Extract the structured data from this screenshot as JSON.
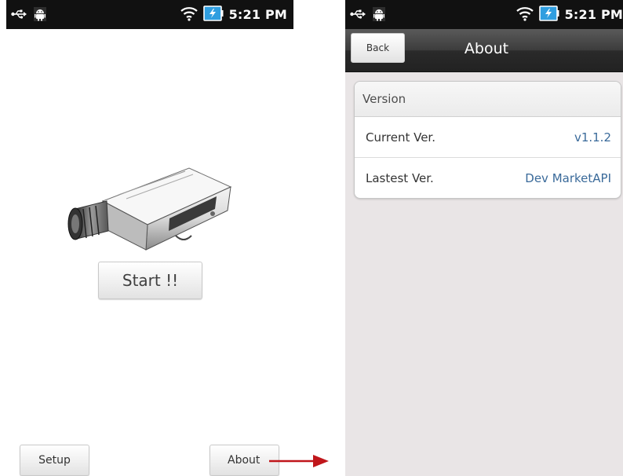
{
  "main_screen": {
    "status_bar": {
      "time": "5:21 PM"
    },
    "start_label": "Start !!",
    "setup_label": "Setup",
    "about_label": "About"
  },
  "about_screen": {
    "status_bar": {
      "time": "5:21 PM"
    },
    "back_label": "Back",
    "title": "About",
    "section_header": "Version",
    "rows": [
      {
        "label": "Current Ver.",
        "value": "v1.1.2"
      },
      {
        "label": "Lastest Ver.",
        "value": "Dev MarketAPI"
      }
    ]
  },
  "icons": [
    "usb-icon",
    "android-debug-icon",
    "wifi-icon",
    "battery-charging-icon",
    "security-camera-icon",
    "red-arrow-icon"
  ],
  "colors": {
    "arrow": "#c0161b",
    "value_text": "#3a6a9a",
    "statusbar": "#111111"
  }
}
